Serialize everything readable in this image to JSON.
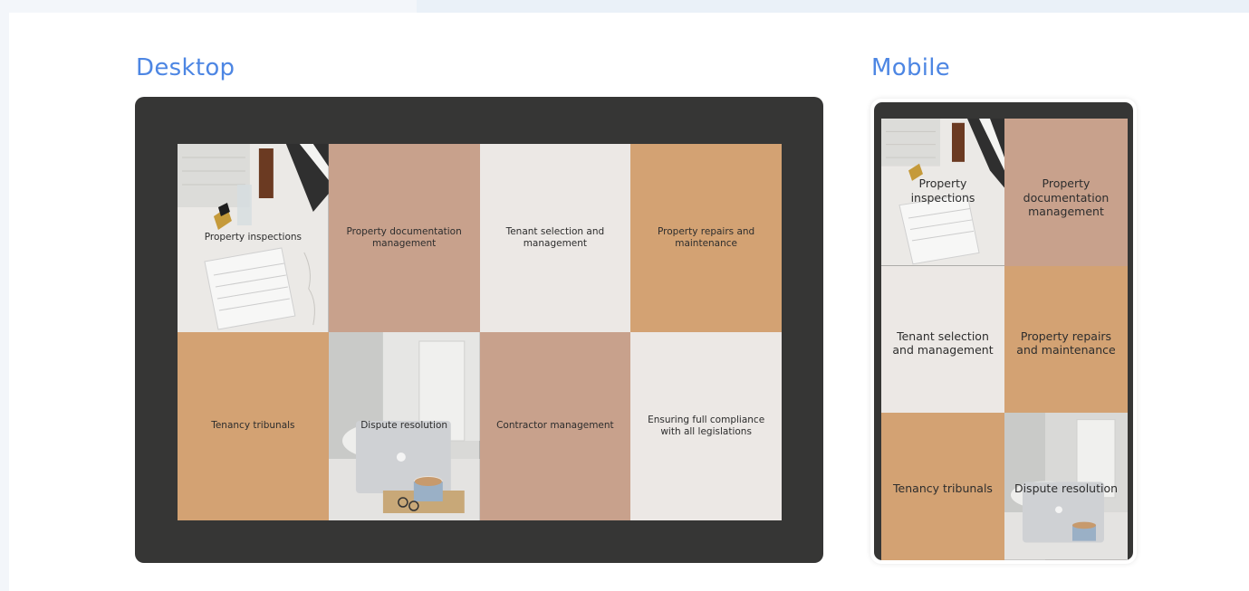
{
  "sections": {
    "desktop_title": "Desktop",
    "mobile_title": "Mobile"
  },
  "tiles": {
    "inspections": "Property inspections",
    "documentation": "Property documentation management",
    "tenant": "Tenant selection and management",
    "repairs": "Property repairs and maintenance",
    "tribunals": "Tenancy tribunals",
    "dispute": "Dispute resolution",
    "contractor": "Contractor management",
    "compliance": "Ensuring full compliance with all legislations"
  },
  "colors": {
    "accent_title": "#4d86e3",
    "frame": "#363635",
    "tile_tan": "#d3a273",
    "tile_pink": "#c8a18c",
    "tile_light": "#ece8e5"
  },
  "icons": {
    "inspections_photo": "desk-calendar-paperwork-photo",
    "dispute_photo": "laptop-coffee-glasses-photo"
  }
}
